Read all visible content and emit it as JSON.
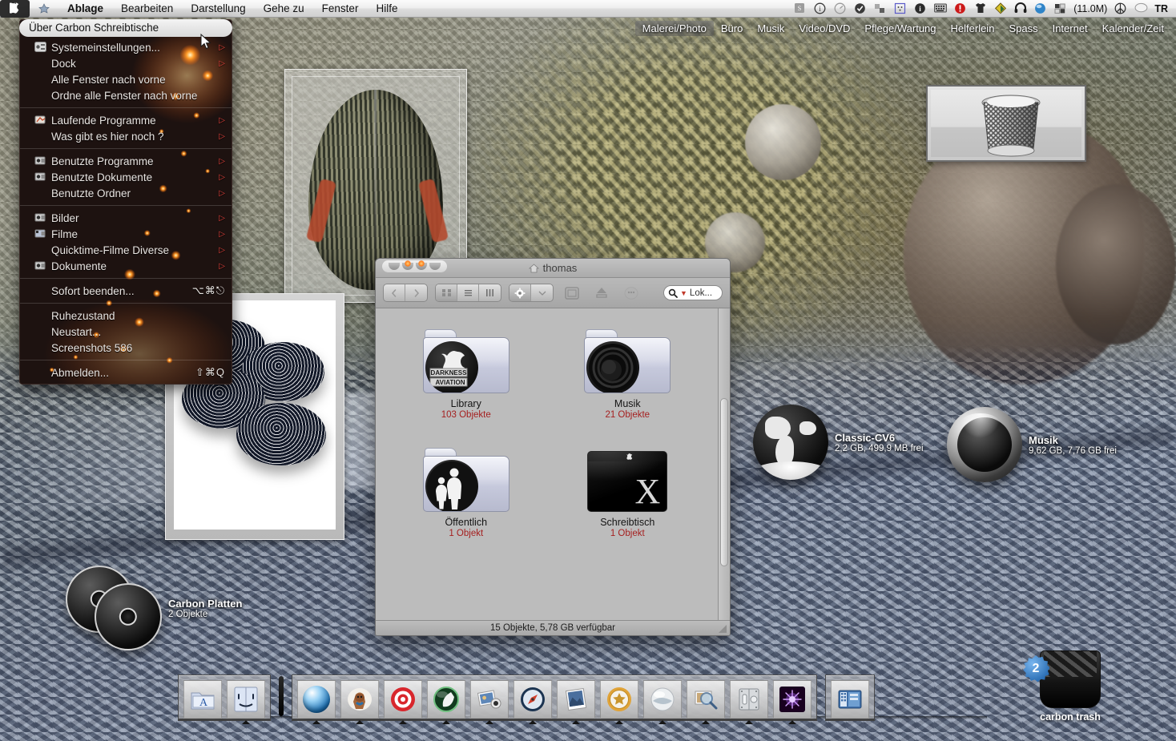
{
  "menubar": {
    "apple_icon": "apple-icon",
    "app_icon": "finder-app-icon",
    "items": [
      {
        "label": "Ablage"
      },
      {
        "label": "Bearbeiten"
      },
      {
        "label": "Darstellung"
      },
      {
        "label": "Gehe zu"
      },
      {
        "label": "Fenster"
      },
      {
        "label": "Hilfe"
      }
    ],
    "status_items": [
      {
        "icon": "script-menu-icon",
        "label": ""
      },
      {
        "icon": "info-circle-icon",
        "label": ""
      },
      {
        "icon": "speedometer-icon",
        "label": ""
      },
      {
        "icon": "check-circle-icon",
        "label": ""
      },
      {
        "icon": "squares-icon",
        "label": ""
      },
      {
        "icon": "dotted-square-icon",
        "label": ""
      },
      {
        "icon": "info-bold-icon",
        "label": ""
      },
      {
        "icon": "keyboard-icon",
        "label": ""
      },
      {
        "icon": "alert-octagon-icon",
        "label": ""
      },
      {
        "icon": "tshirt-icon",
        "label": ""
      },
      {
        "icon": "diamond-icon",
        "label": ""
      },
      {
        "icon": "headphones-icon",
        "label": ""
      },
      {
        "icon": "blue-orb-icon",
        "label": ""
      },
      {
        "icon": "memory-blocks-icon",
        "label": "(11.0M)"
      },
      {
        "icon": "peace-icon",
        "label": ""
      },
      {
        "icon": "speech-bubble-icon",
        "label": ""
      },
      {
        "icon": "keyboard-layout-icon",
        "label": "TR"
      }
    ]
  },
  "categorybar": {
    "items": [
      {
        "label": "Malerei/Photo",
        "selected": true
      },
      {
        "label": "Büro",
        "selected": false
      },
      {
        "label": "Musik",
        "selected": false
      },
      {
        "label": "Video/DVD",
        "selected": false
      },
      {
        "label": "Pflege/Wartung",
        "selected": false
      },
      {
        "label": "Helferlein",
        "selected": false
      },
      {
        "label": "Spass",
        "selected": false
      },
      {
        "label": "Internet",
        "selected": false
      },
      {
        "label": "Kalender/Zeit",
        "selected": false
      }
    ]
  },
  "apple_menu": {
    "title": "Über Carbon Schreibtische",
    "groups": [
      [
        {
          "label": "Systemeinstellungen...",
          "icon": "sysprefs-icon",
          "arrow": true,
          "shortcut": ""
        },
        {
          "label": "Dock",
          "icon": "",
          "arrow": true,
          "shortcut": ""
        },
        {
          "label": "Alle Fenster nach vorne",
          "icon": "",
          "arrow": false,
          "shortcut": ""
        },
        {
          "label": "Ordne alle Fenster nach vorne",
          "icon": "",
          "arrow": false,
          "shortcut": ""
        }
      ],
      [
        {
          "label": "Laufende Programme",
          "icon": "running-apps-icon",
          "arrow": true,
          "shortcut": ""
        },
        {
          "label": "Was gibt es hier noch ?",
          "icon": "",
          "arrow": true,
          "shortcut": ""
        }
      ],
      [
        {
          "label": "Benutzte Programme",
          "icon": "recent-apps-icon",
          "arrow": true,
          "shortcut": ""
        },
        {
          "label": "Benutzte Dokumente",
          "icon": "recent-docs-icon",
          "arrow": true,
          "shortcut": ""
        },
        {
          "label": "Benutzte Ordner",
          "icon": "",
          "arrow": true,
          "shortcut": ""
        }
      ],
      [
        {
          "label": "Bilder",
          "icon": "pictures-icon",
          "arrow": true,
          "shortcut": ""
        },
        {
          "label": "Filme",
          "icon": "movies-icon",
          "arrow": true,
          "shortcut": ""
        },
        {
          "label": "Quicktime-Filme Diverse",
          "icon": "",
          "arrow": true,
          "shortcut": ""
        },
        {
          "label": "Dokumente",
          "icon": "documents-icon",
          "arrow": true,
          "shortcut": ""
        }
      ],
      [
        {
          "label": "Sofort beenden...",
          "icon": "",
          "arrow": false,
          "shortcut": "⌥⌘⎋"
        }
      ],
      [
        {
          "label": "Ruhezustand",
          "icon": "",
          "arrow": false,
          "shortcut": ""
        },
        {
          "label": "Neustart...",
          "icon": "",
          "arrow": false,
          "shortcut": ""
        },
        {
          "label": "Screenshots 586",
          "icon": "",
          "arrow": false,
          "shortcut": ""
        }
      ],
      [
        {
          "label": "Abmelden...",
          "icon": "",
          "arrow": false,
          "shortcut": "⇧⌘Q"
        }
      ]
    ]
  },
  "finder": {
    "title": "thomas",
    "title_icon": "home-icon",
    "toolbar": {
      "back_label": "",
      "forward_label": "",
      "view_icon_label": "",
      "view_list_label": "",
      "view_column_label": "",
      "action_label": "",
      "burn_label": "",
      "eject_label": "",
      "customize_label": "",
      "search_placeholder": "Lok..."
    },
    "items": [
      {
        "name": "Library",
        "count": "103 Objekte",
        "icon": "folder-darkness-aviation"
      },
      {
        "name": "Musik",
        "count": "21 Objekte",
        "icon": "folder-music"
      },
      {
        "name": "Öffentlich",
        "count": "1 Objekt",
        "icon": "folder-public"
      },
      {
        "name": "Schreibtisch",
        "count": "1 Objekt",
        "icon": "desktop-osx"
      }
    ],
    "status": "15 Objekte, 5,78 GB verfügbar"
  },
  "desktop_icons": [
    {
      "name": "Carbon Platten",
      "sub": "2 Objekte",
      "icon": "discs-icon"
    },
    {
      "name": "Classic-CV6",
      "sub": "2,2 GB, 499,9 MB frei",
      "icon": "globe-drive-icon"
    },
    {
      "name": "Musik",
      "sub": "9,62 GB, 7,76 GB frei",
      "icon": "sphere-drive-icon"
    }
  ],
  "trash": {
    "label": "carbon trash",
    "badge": "2",
    "icon": "trash-icon"
  },
  "dock": {
    "left_items": [
      {
        "icon": "app-store-folder-icon",
        "label": ""
      },
      {
        "icon": "finder-icon",
        "label": ""
      }
    ],
    "main_items": [
      {
        "icon": "blue-wave-orb-icon",
        "label": ""
      },
      {
        "icon": "dog-icon",
        "label": ""
      },
      {
        "icon": "target-icon",
        "label": ""
      },
      {
        "icon": "green-feather-orb-icon",
        "label": ""
      },
      {
        "icon": "photos-icon",
        "label": ""
      },
      {
        "icon": "compass-icon",
        "label": ""
      },
      {
        "icon": "picture-frame-icon",
        "label": ""
      },
      {
        "icon": "gold-seal-icon",
        "label": ""
      },
      {
        "icon": "silver-orb-icon",
        "label": ""
      },
      {
        "icon": "magnifier-photo-icon",
        "label": ""
      },
      {
        "icon": "metal-toggle-icon",
        "label": ""
      },
      {
        "icon": "purple-star-icon",
        "label": ""
      }
    ],
    "right_items": [
      {
        "icon": "window-grid-icon",
        "label": ""
      }
    ]
  },
  "picture_windows": [
    {
      "name": "helmet-preview",
      "caption": ""
    },
    {
      "name": "wheels-preview",
      "caption": ""
    },
    {
      "name": "trash-preview",
      "caption": ""
    }
  ],
  "colors": {
    "menu_bg": "#201513",
    "menu_text": "#e8e4e1",
    "arrow_red": "#e0403a",
    "count_red": "#a52020",
    "badge_blue": "#2c6fb5",
    "finder_bg": "#bcbcbc"
  }
}
